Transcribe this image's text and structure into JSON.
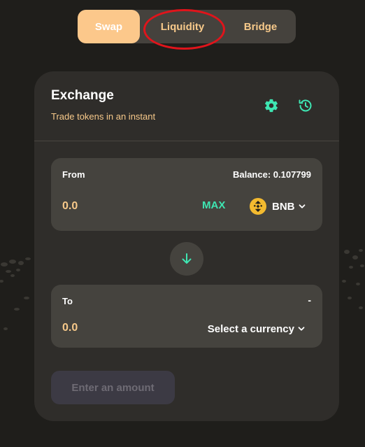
{
  "tabs": [
    {
      "label": "Swap",
      "active": true
    },
    {
      "label": "Liquidity",
      "active": false
    },
    {
      "label": "Bridge",
      "active": false
    }
  ],
  "exchange": {
    "title": "Exchange",
    "subtitle": "Trade tokens in an instant",
    "icons": {
      "settings": "gear-icon",
      "history": "history-icon"
    }
  },
  "from": {
    "label": "From",
    "balance": "Balance: 0.107799",
    "amount_placeholder": "0.0",
    "max_label": "MAX",
    "token_symbol": "BNB",
    "token_icon": "bnb-logo-icon"
  },
  "switch_icon": "arrow-down-icon",
  "to": {
    "label": "To",
    "balance": "-",
    "amount_placeholder": "0.0",
    "currency_label": "Select a currency"
  },
  "action": {
    "label": "Enter an amount",
    "disabled": true
  },
  "annotation": {
    "highlight": "Liquidity",
    "color": "#e0141b"
  },
  "colors": {
    "background": "#1f1e1b",
    "card": "#2f2d2a",
    "panel": "#45433e",
    "accent": "#f7c98a",
    "active_tab": "#fcc88b",
    "max": "#3ee6b2",
    "icon_teal": "#3ee6b2",
    "bnb": "#f3ba2f"
  }
}
